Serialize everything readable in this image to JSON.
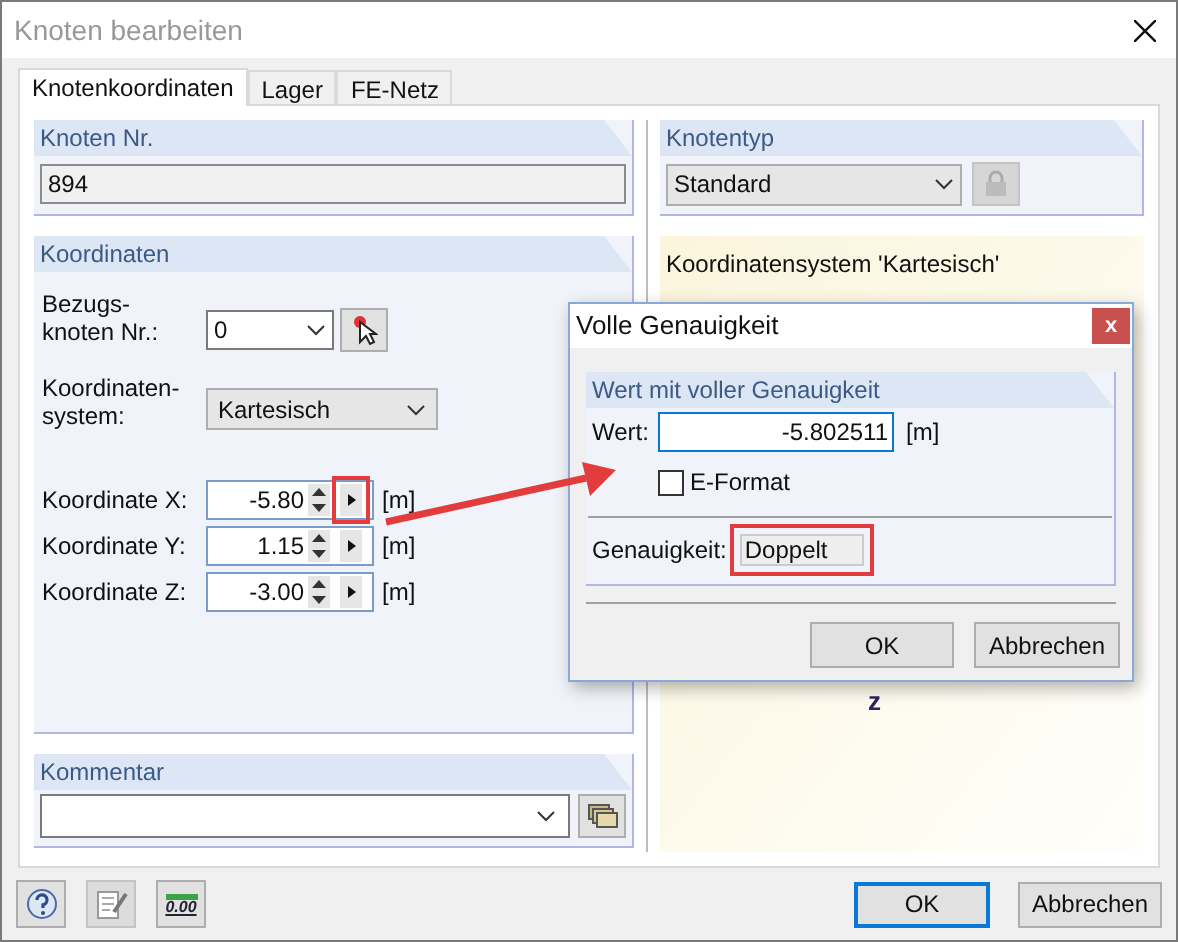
{
  "window": {
    "title": "Knoten bearbeiten"
  },
  "tabs": [
    {
      "label": "Knotenkoordinaten",
      "selected": true
    },
    {
      "label": "Lager",
      "selected": false
    },
    {
      "label": "FE-Netz",
      "selected": false
    }
  ],
  "knoten_nr": {
    "title": "Knoten Nr.",
    "value": "894"
  },
  "knotentyp": {
    "title": "Knotentyp",
    "value": "Standard"
  },
  "koordinaten": {
    "title": "Koordinaten",
    "bezugsknoten": {
      "label_lines": [
        "Bezugs-",
        "knoten Nr.:"
      ],
      "value": "0"
    },
    "system": {
      "label_lines": [
        "Koordinaten-",
        "system:"
      ],
      "value": "Kartesisch"
    },
    "rows": [
      {
        "label": "Koordinate X:",
        "value": "-5.80",
        "unit": "[m]",
        "highlighted": true
      },
      {
        "label": "Koordinate Y:",
        "value": "1.15",
        "unit": "[m]",
        "highlighted": false
      },
      {
        "label": "Koordinate Z:",
        "value": "-3.00",
        "unit": "[m]",
        "highlighted": false
      }
    ]
  },
  "kommentar": {
    "title": "Kommentar"
  },
  "graphic": {
    "title": "Koordinatensystem 'Kartesisch'",
    "axis_label": "z"
  },
  "popup": {
    "title": "Volle Genauigkeit",
    "close": "x",
    "group": "Wert mit voller Genauigkeit",
    "wert": {
      "label": "Wert:",
      "value": "-5.802511",
      "unit": "[m]"
    },
    "e_format": {
      "label": "E-Format",
      "checked": false
    },
    "genauigkeit": {
      "label": "Genauigkeit:",
      "value": "Doppelt",
      "highlighted": true
    },
    "buttons": [
      "OK",
      "Abbrechen"
    ]
  },
  "footer": {
    "decimal_icon": "0.00",
    "buttons": [
      "OK",
      "Abbrechen"
    ]
  }
}
